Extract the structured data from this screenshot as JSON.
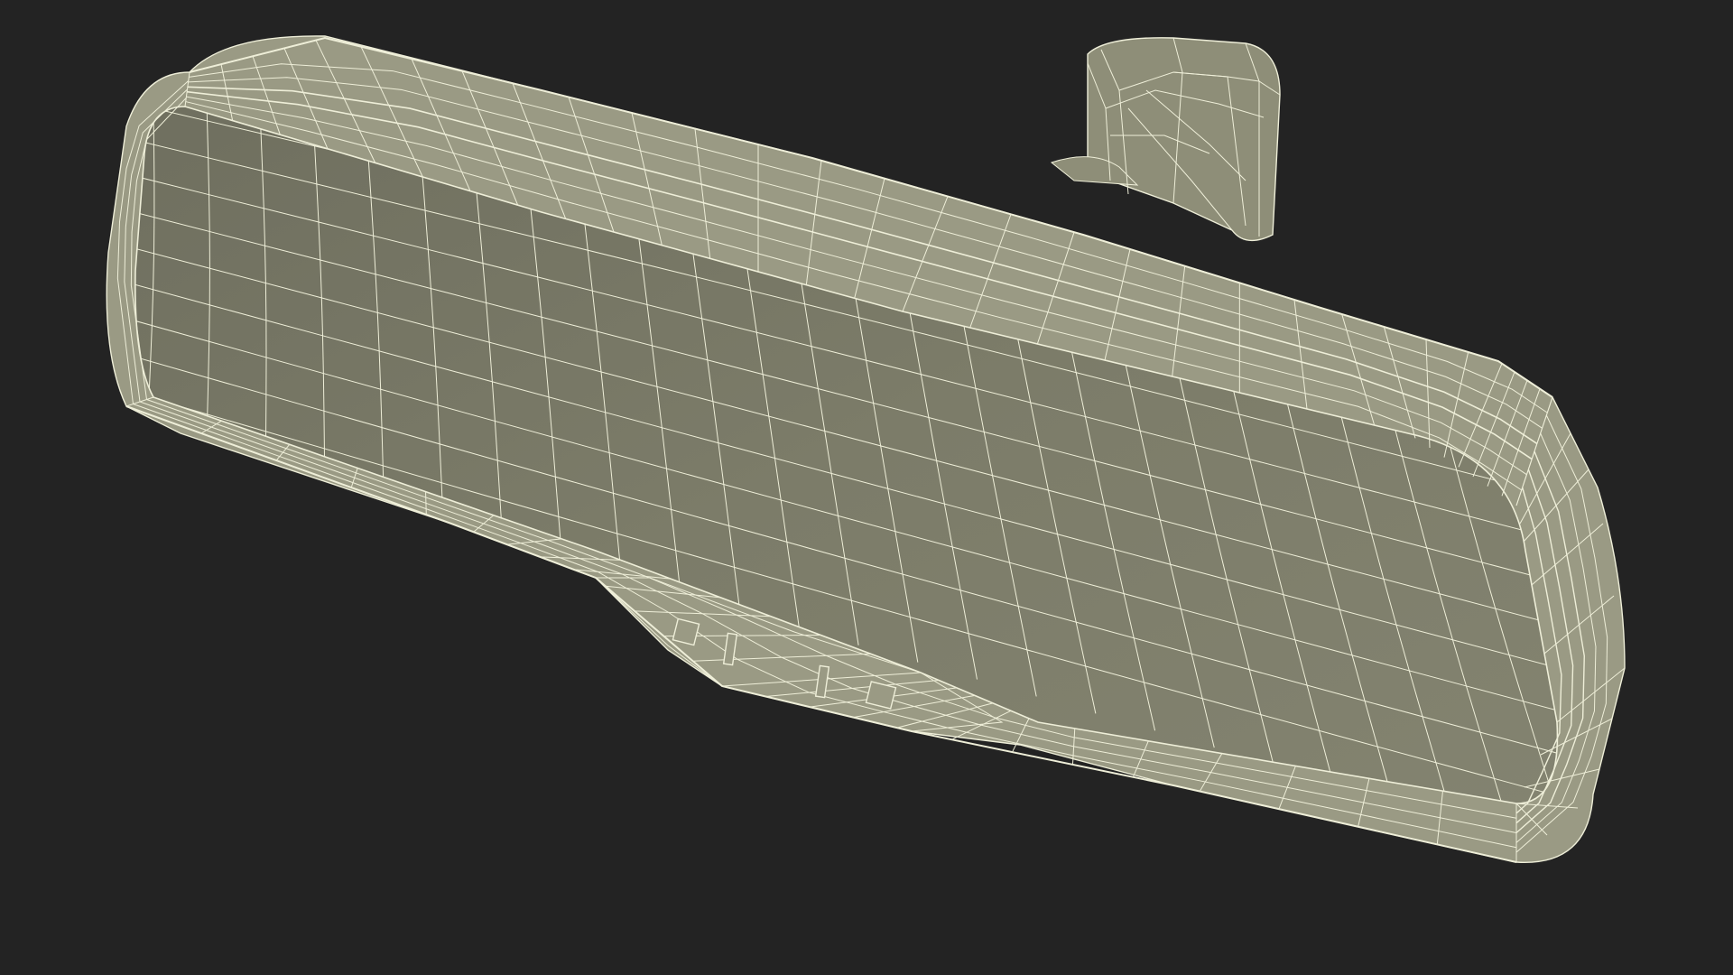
{
  "scene": {
    "subject": "rearview-mirror-wireframe",
    "colors": {
      "background": "#232323",
      "mirror_face": "#7b7b68",
      "mirror_face_light": "#8a8a76",
      "frame": "#9a9a84",
      "frame_top": "#a5a58e",
      "mount": "#8e8e78",
      "wire": "#eeeed8"
    }
  }
}
